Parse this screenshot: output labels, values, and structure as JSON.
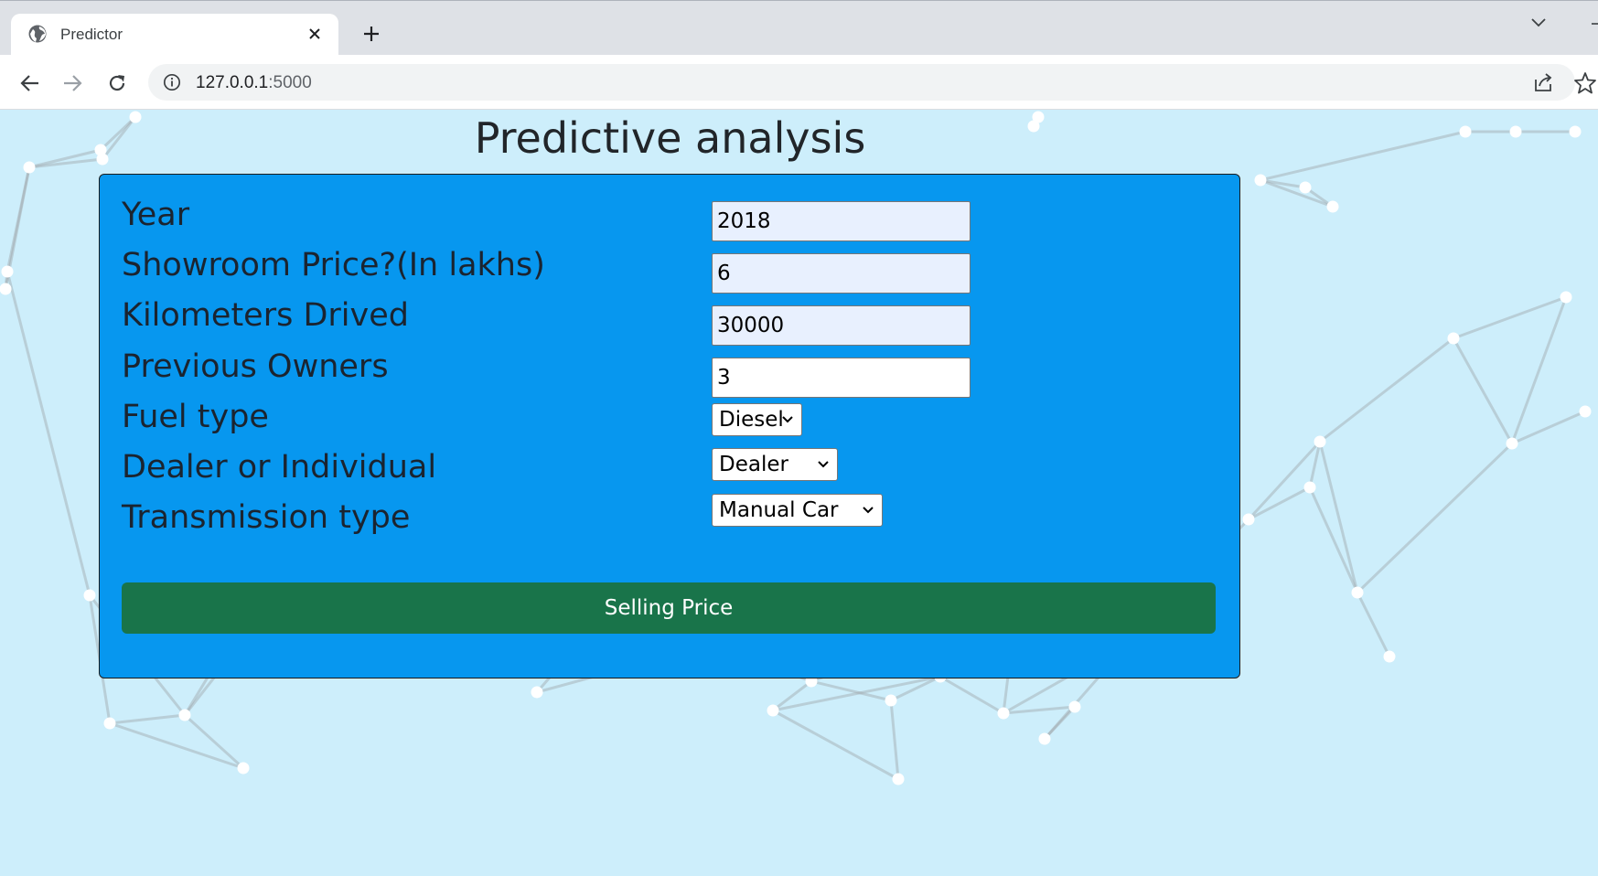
{
  "browser": {
    "tab_title": "Predictor",
    "url_host": "127.0.0.1",
    "url_port": ":5000"
  },
  "page": {
    "heading": "Predictive analysis",
    "fields": [
      {
        "label": "Year",
        "value": "2018"
      },
      {
        "label": "Showroom Price?(In lakhs)",
        "value": "6"
      },
      {
        "label": "Kilometers Drived",
        "value": "30000"
      },
      {
        "label": "Previous Owners",
        "value": "3"
      },
      {
        "label": "Fuel type",
        "value": "Diesel"
      },
      {
        "label": "Dealer or Individual",
        "value": "Dealer"
      },
      {
        "label": "Transmission type",
        "value": "Manual Car"
      }
    ],
    "submit_label": "Selling Price"
  },
  "colors": {
    "background": "#cdeefb",
    "card": "#0797ef",
    "button": "#19744a",
    "autofill": "#e8f0fe"
  }
}
